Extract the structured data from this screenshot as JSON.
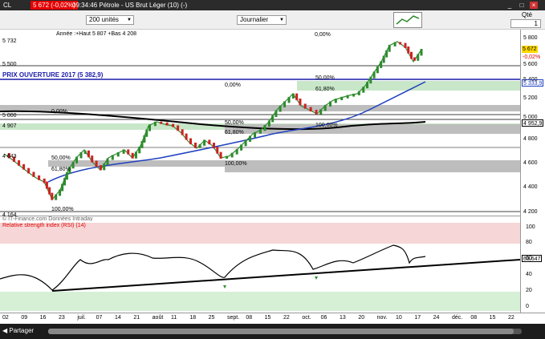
{
  "titlebar": {
    "symbol": "CL",
    "change": "5 672 (-0,02%)",
    "info": "09:34:46 Pétrole - US Brut Léger (10) (-)",
    "controls": [
      "_",
      "□",
      "×"
    ]
  },
  "toolbar": {
    "quantity_select": "200 unités",
    "period_select": "Journalier",
    "qty_label": "Qté",
    "qty_value": "1"
  },
  "chart_header": {
    "legend": "Année :+Haut 5 807 +Bas 4 208",
    "prix_label": "PRIX OUVERTURE 2017 (5 382,9)",
    "source": "© IT-Finance.com Données Intraday"
  },
  "left_labels": {
    "p5732": "5 732",
    "p5500": "5 500",
    "p5000": "5 000",
    "p4907": "4 907",
    "p4643": "4 643",
    "p4164": "4 164"
  },
  "fib_labels": {
    "f1": "0,00%",
    "f2": "0,00%",
    "f3": "0,00%",
    "f4": "50,00%",
    "f5": "61,80%",
    "f6": "100,00%",
    "f7": "50,00%",
    "f8": "61,80%",
    "f9": "100,00%",
    "f10": "50,00%",
    "f11": "61,80%",
    "f12": "100,00%"
  },
  "right_axis": {
    "main_ticks": [
      "5 800",
      "5 600",
      "5 400",
      "5 200",
      "5 000",
      "4 800",
      "4 600",
      "4 400",
      "4 200"
    ],
    "last_price": "5 672",
    "last_change": "-0,02%",
    "ma_blue": "5 333,9",
    "ma_black": "4 952,9",
    "rsi_ticks": [
      "100",
      "80",
      "60",
      "40",
      "20",
      "0"
    ],
    "rsi_value": "63,647"
  },
  "rsi": {
    "title": "Relative strength index (RSI) (14)"
  },
  "x_axis": [
    "02",
    "09",
    "16",
    "23",
    "juil.",
    "07",
    "14",
    "21",
    "août",
    "11",
    "18",
    "25",
    "sept.",
    "08",
    "15",
    "22",
    "oct.",
    "06",
    "13",
    "20",
    "nov.",
    "10",
    "17",
    "24",
    "déc.",
    "08",
    "15",
    "22"
  ],
  "footer": {
    "share": "Partager"
  },
  "colors": {
    "up_candle": "#2e8b2e",
    "down_candle": "#cc2222",
    "ma_blue": "#2040c0",
    "ma_black": "#000000",
    "prix_line": "#1a1aaa",
    "change_badge": "#e60000"
  }
}
